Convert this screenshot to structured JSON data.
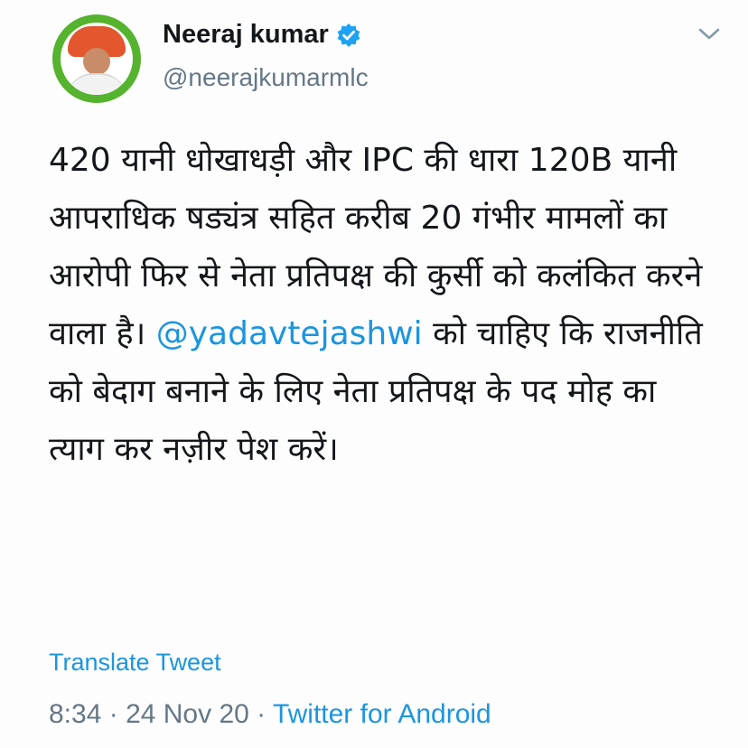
{
  "author": {
    "display_name": "Neeraj kumar",
    "handle": "@neerajkumarmlc",
    "verified": true,
    "avatar_icon": "profile-photo-avatar"
  },
  "tweet": {
    "text_part1": "420 यानी धोखाधड़ी और IPC की धारा 120B यानी आपराधिक षड्यंत्र सहित करीब 20 गंभीर मामलों का आरोपी फिर से नेता प्रतिपक्ष की कुर्सी को कलंकित करने वाला है। ",
    "mention": "@yadavtejashwi",
    "text_part2": " को चाहिए कि राजनीति को बेदाग बनाने के लिए नेता प्रतिपक्ष के पद मोह का त्याग कर नज़ीर पेश करें।",
    "translate_label": "Translate Tweet",
    "time": "8:34",
    "separator": " · ",
    "date": "24 Nov 20",
    "source": "Twitter for Android"
  },
  "icons": {
    "verified": "verified-badge-icon",
    "menu": "chevron-down-icon"
  },
  "colors": {
    "link": "#1b95e0",
    "secondary_text": "#657786",
    "primary_text": "#14171a",
    "verified": "#1da1f2"
  }
}
